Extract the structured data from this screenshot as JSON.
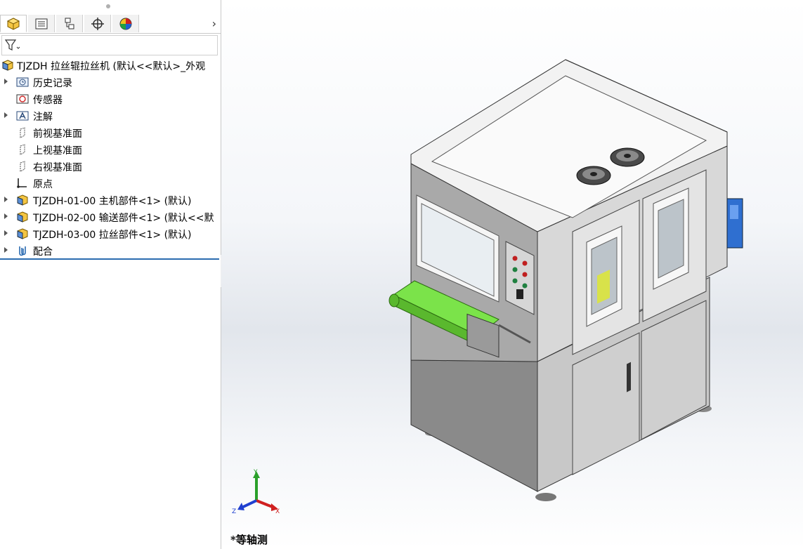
{
  "feature_tabs": [
    "feature-manager",
    "property-manager",
    "configuration-manager",
    "dimxpert-manager",
    "display-manager"
  ],
  "tree": {
    "root": "TJZDH 拉丝辊拉丝机  (默认<<默认>_外观",
    "items": [
      {
        "label": "历史记录",
        "icon": "history-icon",
        "expandable": true
      },
      {
        "label": "传感器",
        "icon": "sensor-icon",
        "expandable": false
      },
      {
        "label": "注解",
        "icon": "annotation-icon",
        "expandable": true
      },
      {
        "label": "前视基准面",
        "icon": "plane-icon",
        "expandable": false
      },
      {
        "label": "上视基准面",
        "icon": "plane-icon",
        "expandable": false
      },
      {
        "label": "右视基准面",
        "icon": "plane-icon",
        "expandable": false
      },
      {
        "label": "原点",
        "icon": "origin-icon",
        "expandable": false
      },
      {
        "label": "TJZDH-01-00 主机部件<1> (默认)",
        "icon": "subassembly-icon",
        "expandable": true
      },
      {
        "label": "TJZDH-02-00 输送部件<1> (默认<<默",
        "icon": "subassembly-icon",
        "expandable": true
      },
      {
        "label": "TJZDH-03-00 拉丝部件<1> (默认)",
        "icon": "subassembly-icon",
        "expandable": true
      },
      {
        "label": "配合",
        "icon": "mates-icon",
        "expandable": true
      }
    ]
  },
  "viewport": {
    "view_label": "*等轴测",
    "triad": {
      "x": "X",
      "y": "Y",
      "z": "Z"
    },
    "colors": {
      "conveyor": "#7be34a",
      "body": "#c9c9c9",
      "x_axis": "#d02020",
      "y_axis": "#2aa02a",
      "z_axis": "#2040d0"
    }
  }
}
